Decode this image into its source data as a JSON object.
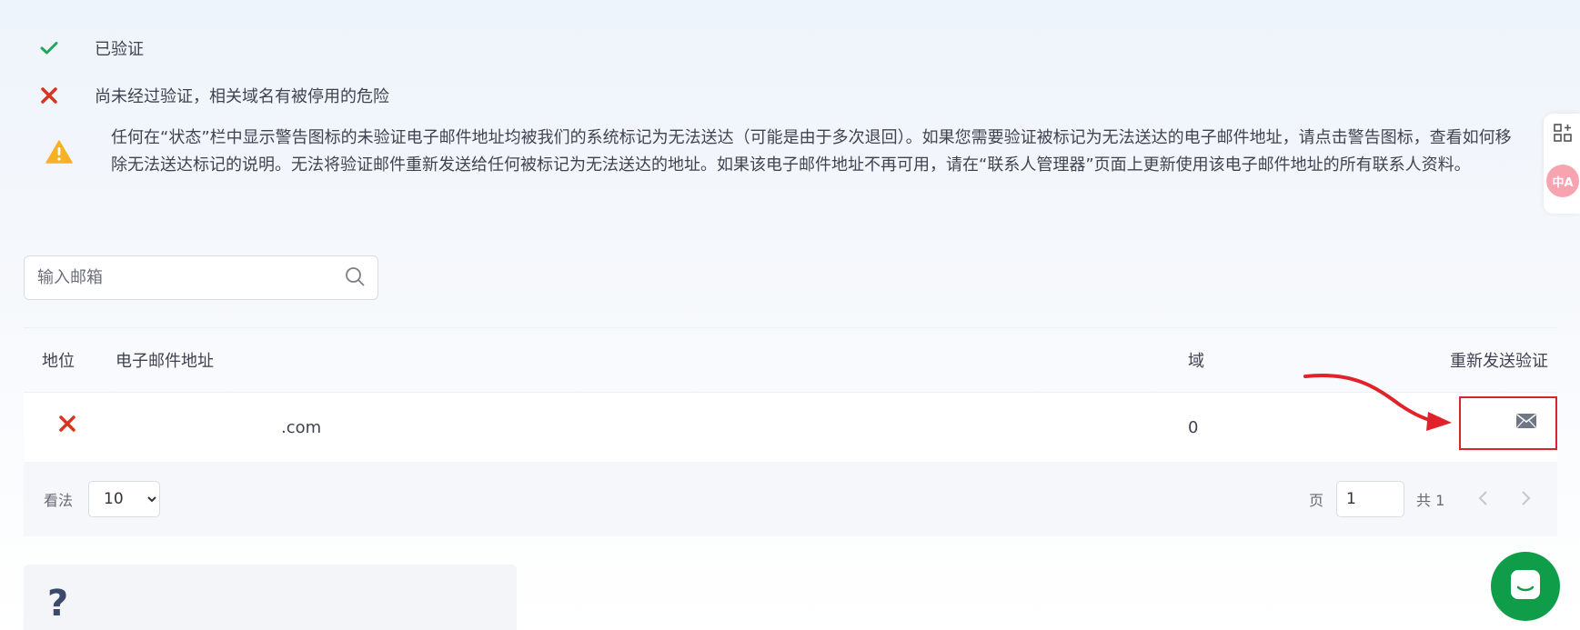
{
  "legend": {
    "verified": {
      "icon": "check-icon",
      "text": "已验证",
      "color": "#23a55a"
    },
    "unverified": {
      "icon": "cross-icon",
      "text": "尚未经过验证，相关域名有被停用的危险",
      "color": "#d9341f"
    },
    "warning": {
      "icon": "warning-icon",
      "text": "任何在“状态”栏中显示警告图标的未验证电子邮件地址均被我们的系统标记为无法送达（可能是由于多次退回）。如果您需要验证被标记为无法送达的电子邮件地址，请点击警告图标，查看如何移除无法送达标记的说明。无法将验证邮件重新发送给任何被标记为无法送达的地址。如果该电子邮件地址不再可用，请在“联系人管理器”页面上更新使用该电子邮件地址的所有联系人资料。",
      "color": "#f5b224"
    }
  },
  "search": {
    "placeholder": "输入邮箱",
    "value": ""
  },
  "table": {
    "headers": {
      "status": "地位",
      "email": "电子邮件地址",
      "domain": "域",
      "resend": "重新发送验证"
    },
    "rows": [
      {
        "status_icon": "cross-icon",
        "email": ".com",
        "domain": "0",
        "resend_icon": "envelope-icon"
      }
    ]
  },
  "pager": {
    "view_label": "看法",
    "page_size": "10",
    "page_label": "页",
    "page_value": "1",
    "total_label": "共 1"
  },
  "help": {
    "icon": "question-icon",
    "symbol": "?"
  },
  "side_tools": {
    "translate_label": "中A"
  },
  "colors": {
    "accent_red": "#d9262b",
    "chat_green": "#0f9d4a"
  }
}
